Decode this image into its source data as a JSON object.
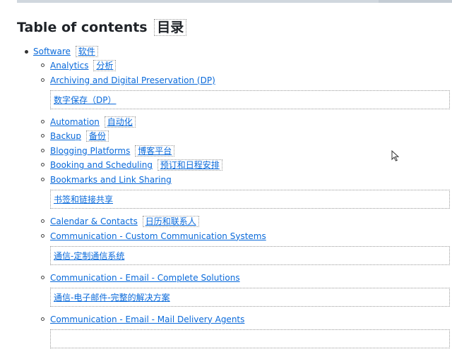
{
  "heading": {
    "text": "Table of contents",
    "translation": "目录"
  },
  "toc": {
    "top": {
      "label": "Software",
      "translation": "软件"
    },
    "items": [
      {
        "label": "Analytics",
        "translation": "分析",
        "block": false
      },
      {
        "label": "Archiving and Digital Preservation (DP)",
        "translation": "数字保存（DP）",
        "block": true
      },
      {
        "label": "Automation",
        "translation": "自动化",
        "block": false
      },
      {
        "label": "Backup",
        "translation": "备份",
        "block": false
      },
      {
        "label": "Blogging Platforms",
        "translation": "博客平台",
        "block": false
      },
      {
        "label": "Booking and Scheduling",
        "translation": "预订和日程安排",
        "block": false
      },
      {
        "label": "Bookmarks and Link Sharing",
        "translation": "书签和链接共享",
        "block": true
      },
      {
        "label": "Calendar & Contacts",
        "translation": "日历和联系人",
        "block": false
      },
      {
        "label": "Communication - Custom Communication Systems",
        "translation": "通信-定制通信系统",
        "block": true
      },
      {
        "label": "Communication - Email - Complete Solutions",
        "translation": "通信-电子邮件-完整的解决方案",
        "block": true
      },
      {
        "label": "Communication - Email - Mail Delivery Agents",
        "translation": "",
        "block": true
      }
    ]
  },
  "colors": {
    "link": "#0969da",
    "border": "#9a9a9a"
  }
}
